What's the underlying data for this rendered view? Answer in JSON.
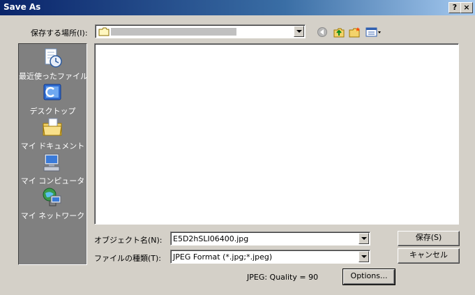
{
  "window": {
    "title": "Save As",
    "help_label": "?",
    "close_label": "×"
  },
  "location": {
    "label": "保存する場所(I):"
  },
  "places": [
    {
      "label": "最近使ったファイル",
      "icon": "recent-files-icon"
    },
    {
      "label": "デスクトップ",
      "icon": "desktop-icon"
    },
    {
      "label": "マイ ドキュメント",
      "icon": "my-documents-icon"
    },
    {
      "label": "マイ コンピュータ",
      "icon": "my-computer-icon"
    },
    {
      "label": "マイ ネットワーク",
      "icon": "my-network-icon"
    }
  ],
  "filename": {
    "label": "オブジェクト名(N):",
    "value": "E5D2hSLI06400.jpg"
  },
  "filetype": {
    "label": "ファイルの種類(T):",
    "value": "JPEG Format (*.jpg;*.jpeg)"
  },
  "buttons": {
    "save": "保存(S)",
    "cancel": "キャンセル",
    "options": "Options..."
  },
  "quality_text": "JPEG: Quality = 90"
}
